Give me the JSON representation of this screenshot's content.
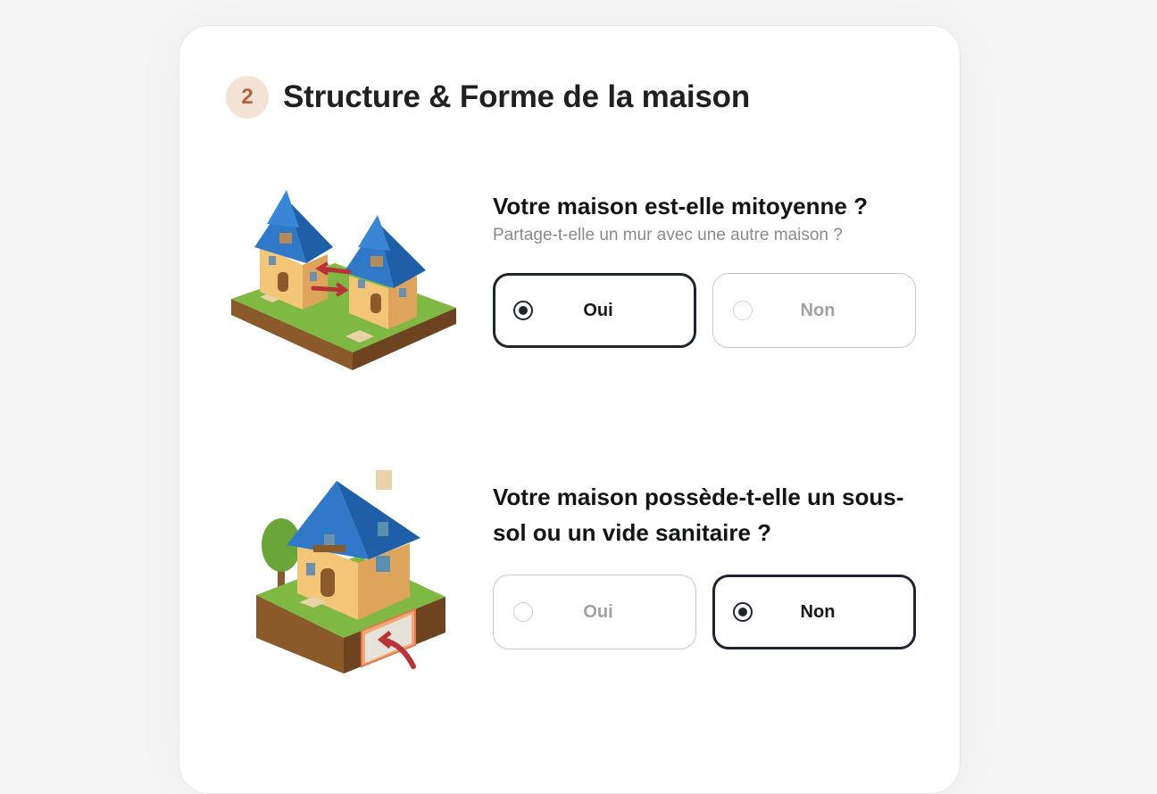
{
  "section": {
    "number": "2",
    "title": "Structure & Forme de la maison",
    "accent_color": "#b5623a",
    "badge_bg": "#f3e2d6"
  },
  "questions": [
    {
      "title": "Votre maison est-elle mitoyenne ?",
      "subtitle": "Partage-t-elle un mur avec une autre maison ?",
      "illustration": "semi-detached-houses-illustration",
      "options": [
        {
          "label": "Oui",
          "selected": true
        },
        {
          "label": "Non",
          "selected": false
        }
      ]
    },
    {
      "title_line1": "Votre maison possède-t-elle un sous-",
      "title_line2": "sol ou un vide sanitaire ?",
      "illustration": "house-basement-illustration",
      "options": [
        {
          "label": "Oui",
          "selected": false
        },
        {
          "label": "Non",
          "selected": true
        }
      ]
    }
  ]
}
